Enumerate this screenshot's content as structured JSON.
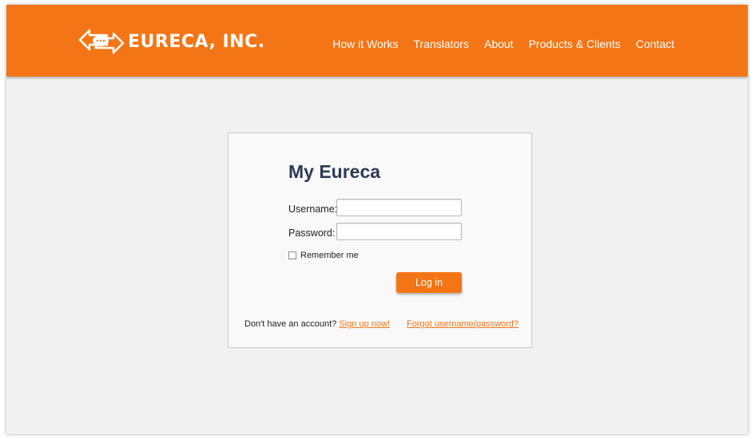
{
  "header": {
    "logo_text": "EURECA, INC.",
    "nav": [
      "How it Works",
      "Translators",
      "About",
      "Products & Clients",
      "Contact"
    ]
  },
  "login": {
    "title": "My Eureca",
    "username_label": "Username:",
    "username_value": "",
    "password_label": "Password:",
    "password_value": "",
    "remember_label": "Remember me",
    "remember_checked": false,
    "login_button": "Log in",
    "no_account_text": "Don't have an account?",
    "signup_link": "Sign up now!",
    "forgot_link": "Forgot username/password?"
  },
  "colors": {
    "brand": "#f47516",
    "title": "#2b3a55",
    "background": "#f1f1f1"
  },
  "icons": {
    "logo": "chat-bubble-double-arrow-icon"
  }
}
